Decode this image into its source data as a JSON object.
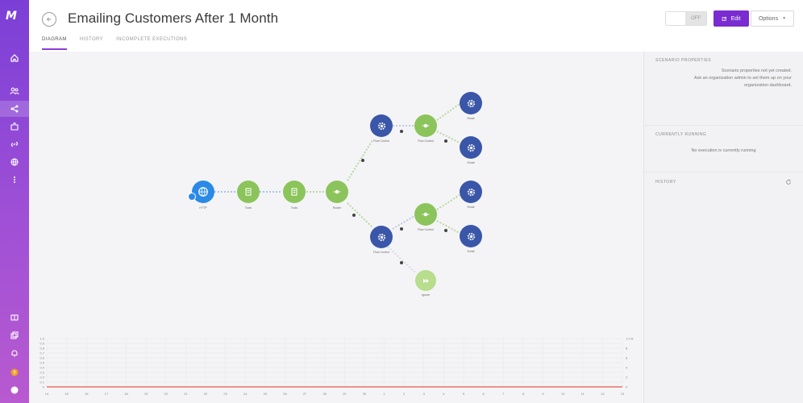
{
  "app": {
    "title": "Emailing Customers After 1 Month",
    "logo_text": "M",
    "accent": "#7a2cd0"
  },
  "tabs": [
    {
      "label": "DIAGRAM",
      "active": true
    },
    {
      "label": "HISTORY",
      "active": false
    },
    {
      "label": "INCOMPLETE EXECUTIONS",
      "active": false
    }
  ],
  "controls": {
    "toggle_label": "OFF",
    "edit_label": "Edit",
    "options_label": "Options"
  },
  "sidebar_icons": [
    "home-icon",
    "team-icon",
    "share-icon",
    "puzzle-icon",
    "link-icon",
    "globe-icon",
    "more-icon",
    "book-icon",
    "templates-icon",
    "bell-icon",
    "help-icon",
    "avatar"
  ],
  "nodes": {
    "http": {
      "label": "HTTP"
    },
    "tools1": {
      "label": "Tools"
    },
    "tools2": {
      "label": "Tools"
    },
    "router": {
      "label": "Router"
    },
    "flow1": {
      "label": "Flow Control"
    },
    "flow2": {
      "label": "Flow Control"
    },
    "email1": {
      "label": "Email"
    },
    "email2": {
      "label": "Email"
    },
    "email3": {
      "label": "Email"
    },
    "email4": {
      "label": "Email"
    },
    "flowA": {
      "label": "Flow Control"
    },
    "flowB": {
      "label": "Flow Control"
    },
    "ignore": {
      "label": "Ignore"
    }
  },
  "panel": {
    "scenario_heading": "SCENARIO PROPERTIES",
    "scenario_text_1": "Scenario properties not yet created.",
    "scenario_text_2": "Ask an organization admin to set them up on your",
    "scenario_text_3": "organization dashboard.",
    "running_heading": "CURRENTLY RUNNING",
    "running_text": "No execution is currently running",
    "history_heading": "HISTORY"
  },
  "chart_data": {
    "type": "line",
    "x": [
      "14",
      "15",
      "16",
      "17",
      "18",
      "19",
      "20",
      "21",
      "22",
      "23",
      "24",
      "25",
      "26",
      "27",
      "28",
      "29",
      "30",
      "1",
      "2",
      "3",
      "4",
      "5",
      "6",
      "7",
      "8",
      "9",
      "10",
      "11",
      "12",
      "13"
    ],
    "y_left_ticks": [
      "1.0",
      "0.9",
      "0.8",
      "0.7",
      "0.6",
      "0.5",
      "0.4",
      "0.3",
      "0.2",
      "0.1",
      "0"
    ],
    "y_right_ticks": [
      "1.0 B",
      "8",
      "6",
      "4",
      "2",
      "0"
    ],
    "series": [
      {
        "values": [
          0,
          0,
          0,
          0,
          0,
          0,
          0,
          0,
          0,
          0,
          0,
          0,
          0,
          0,
          0,
          0,
          0,
          0,
          0,
          0,
          0,
          0,
          0,
          0,
          0,
          0,
          0,
          0,
          0,
          0
        ],
        "color": "#e8736a"
      }
    ],
    "ylim": [
      0,
      1
    ],
    "grid": true
  }
}
